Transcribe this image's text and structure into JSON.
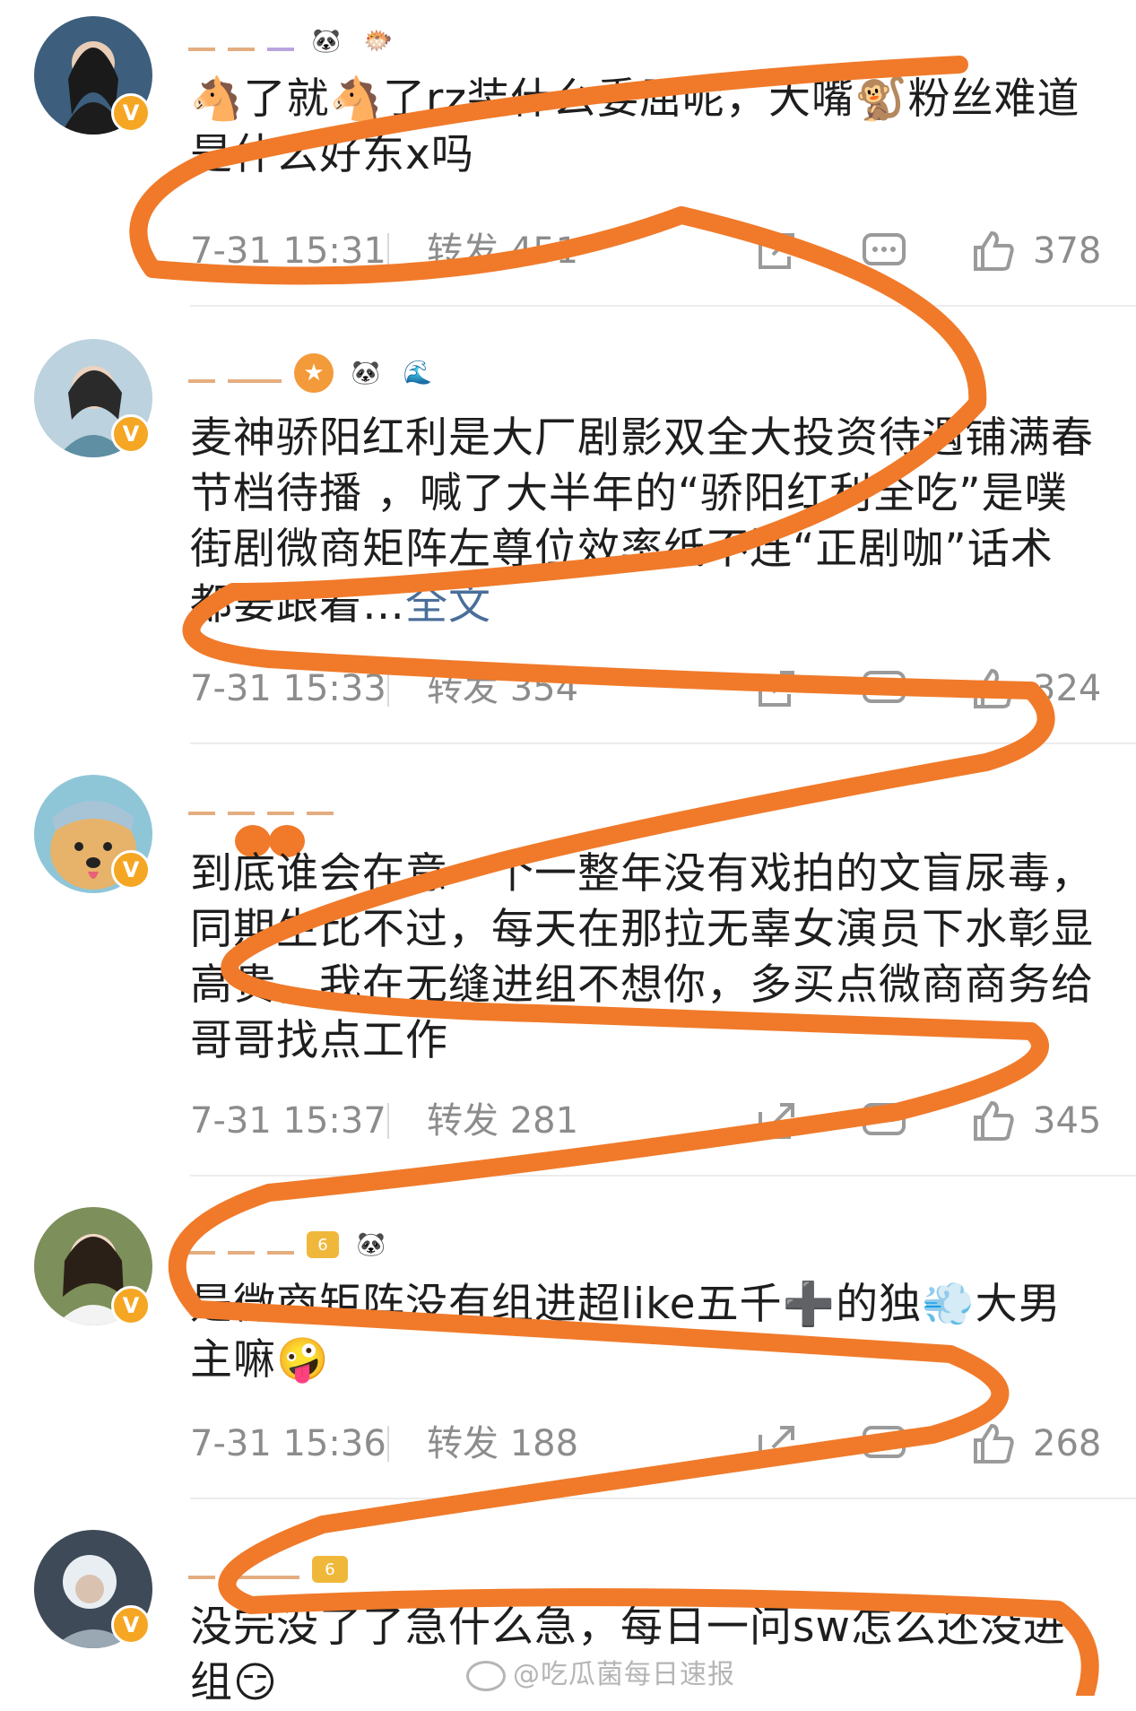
{
  "comments": [
    {
      "text": "🐴了就🐴了rz装什么委屈呢，大嘴🐒粉丝难道是什么好东x吗",
      "more": "",
      "time": "7-31 15:31",
      "repost": "转发 451",
      "likes": "378",
      "avatar_color": "#4a6a8a",
      "emojis": [
        "🐼",
        "🐡"
      ]
    },
    {
      "text": "麦神骄阳红利是大厂剧影双全大投资待遇铺满春节档待播 ，喊了大半年的“骄阳红利全吃”是噗街剧微商矩阵左尊位效率纸不连“正剧咖”话术都要跟着…",
      "more": "全文",
      "time": "7-31 15:33",
      "repost": "转发 354",
      "likes": "324",
      "avatar_color": "#6a8fa8",
      "emojis": [
        "🐼",
        "🌊"
      ]
    },
    {
      "text": "到底谁会在意一个一整年没有戏拍的文盲尿毒，同期生比不过，每天在那拉无辜女演员下水彰显高贵，我在无缝进组不想你，多买点微商商务给哥哥找点工作",
      "more": "",
      "time": "7-31 15:37",
      "repost": "转发 281",
      "likes": "345",
      "avatar_color": "#c9a06a",
      "emojis": []
    },
    {
      "text": "是微商矩阵没有组进超like五千➕的独💨大男主嘛🤪",
      "more": "",
      "time": "7-31 15:36",
      "repost": "转发 188",
      "likes": "268",
      "avatar_color": "#7a8a6a",
      "emojis": [
        "🐼"
      ]
    },
    {
      "text": "没完没了了急什么急，每日一问sw怎么还没进组😏",
      "more": "",
      "time": "",
      "repost": "",
      "likes": "",
      "avatar_color": "#5a6a7a",
      "emojis": []
    }
  ],
  "watermark": "@吃瓜菌每日速报",
  "colors": {
    "scribble": "#f07a2a",
    "vip_badge": "#f5a623",
    "meta_text": "#8c8c8c"
  }
}
